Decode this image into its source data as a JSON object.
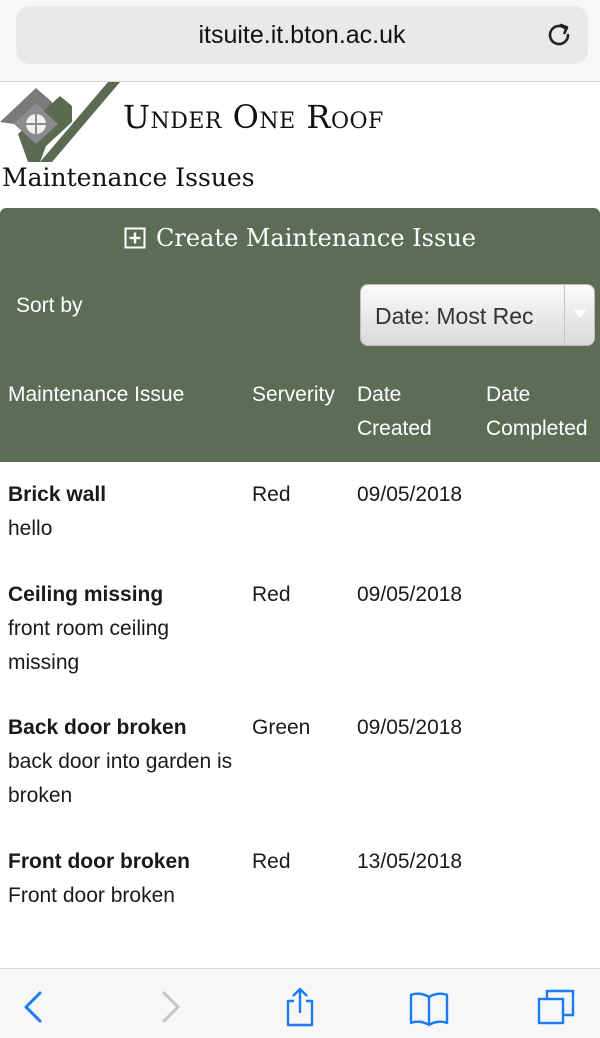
{
  "browser": {
    "url": "itsuite.it.bton.ac.uk"
  },
  "brand": {
    "name": "Under One Roof"
  },
  "page": {
    "title": "Maintenance Issues",
    "create_label": "Create Maintenance Issue"
  },
  "sort": {
    "label": "Sort by",
    "selected": "Date: Most Rec"
  },
  "table": {
    "headers": {
      "issue": "Maintenance Issue",
      "severity": "Serverity",
      "created_1": "Date",
      "created_2": "Created",
      "completed_1": "Date",
      "completed_2": "Completed"
    },
    "rows": [
      {
        "title": "Brick wall",
        "description": "hello",
        "severity": "Red",
        "created": "09/05/2018",
        "completed": ""
      },
      {
        "title": "Ceiling missing",
        "description": "front room ceiling missing",
        "severity": "Red",
        "created": "09/05/2018",
        "completed": ""
      },
      {
        "title": "Back door broken",
        "description": "back door into garden is broken",
        "severity": "Green",
        "created": "09/05/2018",
        "completed": ""
      },
      {
        "title": "Front door broken",
        "description": "Front door broken",
        "severity": "Red",
        "created": "13/05/2018",
        "completed": ""
      }
    ]
  },
  "colors": {
    "accent": "#5d6d55",
    "ios_blue": "#1a7cf5"
  },
  "toolbar": {
    "icons": [
      "back-icon",
      "forward-icon",
      "share-icon",
      "bookmarks-icon",
      "tabs-icon"
    ]
  }
}
